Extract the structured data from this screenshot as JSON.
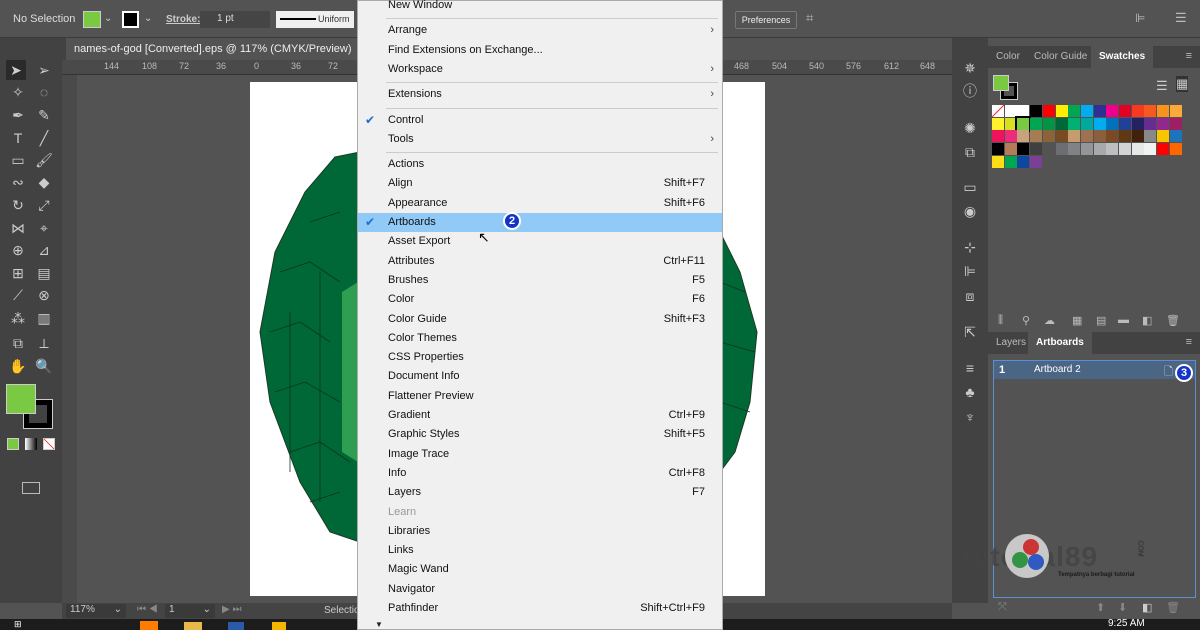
{
  "control": {
    "selection": "No Selection",
    "stroke_label": "Stroke:",
    "stroke_value": "1 pt",
    "profile": "Uniform",
    "preferences": "Preferences",
    "fill_color": "#7ac943"
  },
  "document": {
    "tab_title": "names-of-god [Converted].eps @ 117% (CMYK/Preview)",
    "ruler_ticks": [
      "144",
      "108",
      "72",
      "36",
      "0",
      "36",
      "72",
      "468",
      "504",
      "540",
      "576",
      "612",
      "648"
    ]
  },
  "status": {
    "zoom": "117%",
    "artboard": "1",
    "tool": "Selection"
  },
  "menu": {
    "items": [
      {
        "label": "New Window"
      },
      {
        "sep": true
      },
      {
        "label": "Arrange",
        "sub": true
      },
      {
        "label": "Find Extensions on Exchange..."
      },
      {
        "label": "Workspace",
        "sub": true
      },
      {
        "sep": true
      },
      {
        "label": "Extensions",
        "sub": true
      },
      {
        "sep": true
      },
      {
        "label": "Control",
        "checked": true
      },
      {
        "label": "Tools",
        "sub": true
      },
      {
        "sep": true
      },
      {
        "label": "Actions"
      },
      {
        "label": "Align",
        "shortcut": "Shift+F7"
      },
      {
        "label": "Appearance",
        "shortcut": "Shift+F6"
      },
      {
        "label": "Artboards",
        "checked": true,
        "highlighted": true
      },
      {
        "label": "Asset Export"
      },
      {
        "label": "Attributes",
        "shortcut": "Ctrl+F11"
      },
      {
        "label": "Brushes",
        "shortcut": "F5"
      },
      {
        "label": "Color",
        "shortcut": "F6"
      },
      {
        "label": "Color Guide",
        "shortcut": "Shift+F3"
      },
      {
        "label": "Color Themes"
      },
      {
        "label": "CSS Properties"
      },
      {
        "label": "Document Info"
      },
      {
        "label": "Flattener Preview"
      },
      {
        "label": "Gradient",
        "shortcut": "Ctrl+F9"
      },
      {
        "label": "Graphic Styles",
        "shortcut": "Shift+F5"
      },
      {
        "label": "Image Trace"
      },
      {
        "label": "Info",
        "shortcut": "Ctrl+F8"
      },
      {
        "label": "Layers",
        "shortcut": "F7"
      },
      {
        "label": "Learn",
        "disabled": true
      },
      {
        "label": "Libraries"
      },
      {
        "label": "Links"
      },
      {
        "label": "Magic Wand"
      },
      {
        "label": "Navigator"
      },
      {
        "label": "Pathfinder",
        "shortcut": "Shift+Ctrl+F9"
      }
    ],
    "badge": "2"
  },
  "swatch_panel": {
    "tabs": [
      "Color",
      "Color Guide",
      "Swatches"
    ],
    "active": "Swatches",
    "colors": [
      "#ffffff",
      "#ffffff",
      "#ffffff",
      "#000000",
      "#ff0000",
      "#ffee00",
      "#00a651",
      "#00aeef",
      "#2e3192",
      "#ec008c",
      "#e30022",
      "#f7391f",
      "#f7581f",
      "#f7941d",
      "#fbaa3a",
      "#fff22a",
      "#d7df23",
      "#7ac943",
      "#00a651",
      "#009444",
      "#006838",
      "#00b271",
      "#00a99d",
      "#00aeef",
      "#0072bc",
      "#21409a",
      "#262262",
      "#662d91",
      "#92278f",
      "#9e1f63",
      "#ed145b",
      "#ee2a7b",
      "#c7a27c",
      "#a67c52",
      "#8c6239",
      "#754c24",
      "#c69c6d",
      "#a0714f",
      "#8b5e3c",
      "#7b4a25",
      "#603913",
      "#42210b",
      "#888888",
      "#f7c600",
      "#1c75bc",
      "#000000",
      "#b57c5a",
      "#000000",
      "#404040",
      "#535353",
      "#6d6e71",
      "#808285",
      "#939598",
      "#a7a9ac",
      "#bcbec0",
      "#d1d3d4",
      "#e6e7e8",
      "#f1f2f2",
      "#ff0000",
      "#ff6600",
      "#ffde17",
      "#00a651",
      "#0d47a1",
      "#7b3f98"
    ]
  },
  "artboard_panel": {
    "tabs": [
      "Layers",
      "Artboards"
    ],
    "active": "Artboards",
    "rows": [
      {
        "num": "1",
        "name": "Artboard 2"
      }
    ],
    "badge": "3"
  },
  "watermark": {
    "text": "tutorial89",
    "tld": "COM",
    "tagline": "Tempatnya berbagi tutorial"
  },
  "taskbar": {
    "time": "9:25 AM"
  }
}
